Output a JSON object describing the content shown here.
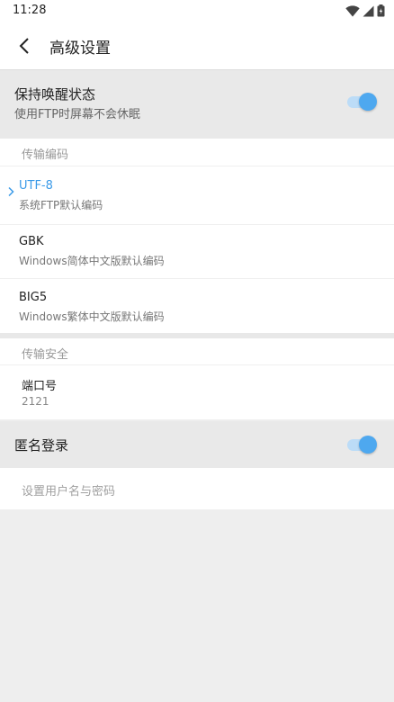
{
  "status_bar": {
    "time": "11:28",
    "icons": [
      "wifi-icon",
      "signal-icon",
      "battery-icon"
    ]
  },
  "app_bar": {
    "title": "高级设置",
    "back_icon": "chevron-left-icon"
  },
  "keep_awake": {
    "title": "保持唤醒状态",
    "subtitle": "使用FTP时屏幕不会休眠",
    "enabled": true
  },
  "encoding": {
    "header": "传输编码",
    "selected_index": 0,
    "items": [
      {
        "name": "UTF-8",
        "description": "系统FTP默认编码"
      },
      {
        "name": "GBK",
        "description": "Windows简体中文版默认编码"
      },
      {
        "name": "BIG5",
        "description": "Windows繁体中文版默认编码"
      }
    ]
  },
  "security": {
    "header": "传输安全",
    "port_label": "端口号",
    "port_value": "2121"
  },
  "anonymous": {
    "title": "匿名登录",
    "enabled": true,
    "credentials_placeholder": "设置用户名与密码"
  },
  "colors": {
    "accent": "#4ea8ef",
    "accent_track": "#bcdcf7",
    "background": "#eeeeee",
    "section_bg": "#e9e9e9"
  }
}
